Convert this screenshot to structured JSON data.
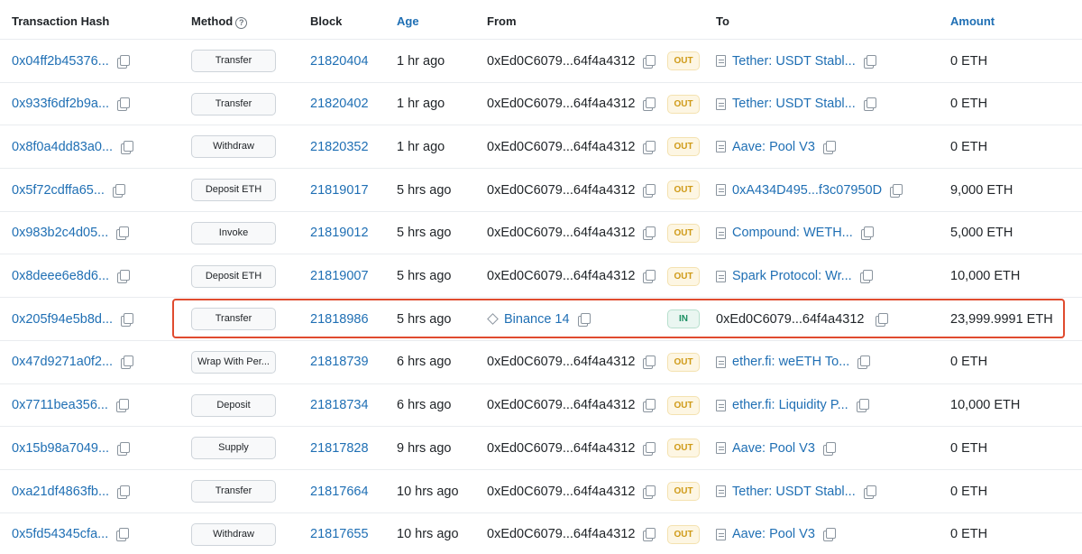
{
  "headers": {
    "hash": "Transaction Hash",
    "method": "Method",
    "block": "Block",
    "age": "Age",
    "from": "From",
    "to": "To",
    "amount": "Amount"
  },
  "rows": [
    {
      "hash": "0x04ff2b45376...",
      "method": "Transfer",
      "block": "21820404",
      "age": "1 hr ago",
      "from": "0xEd0C6079...64f4a4312",
      "dir": "OUT",
      "to": "Tether: USDT Stabl...",
      "amount": "0 ETH"
    },
    {
      "hash": "0x933f6df2b9a...",
      "method": "Transfer",
      "block": "21820402",
      "age": "1 hr ago",
      "from": "0xEd0C6079...64f4a4312",
      "dir": "OUT",
      "to": "Tether: USDT Stabl...",
      "amount": "0 ETH"
    },
    {
      "hash": "0x8f0a4dd83a0...",
      "method": "Withdraw",
      "block": "21820352",
      "age": "1 hr ago",
      "from": "0xEd0C6079...64f4a4312",
      "dir": "OUT",
      "to": "Aave: Pool V3",
      "amount": "0 ETH"
    },
    {
      "hash": "0x5f72cdffa65...",
      "method": "Deposit ETH",
      "block": "21819017",
      "age": "5 hrs ago",
      "from": "0xEd0C6079...64f4a4312",
      "dir": "OUT",
      "to": "0xA434D495...f3c07950D",
      "amount": "9,000 ETH"
    },
    {
      "hash": "0x983b2c4d05...",
      "method": "Invoke",
      "block": "21819012",
      "age": "5 hrs ago",
      "from": "0xEd0C6079...64f4a4312",
      "dir": "OUT",
      "to": "Compound: WETH...",
      "amount": "5,000 ETH"
    },
    {
      "hash": "0x8deee6e8d6...",
      "method": "Deposit ETH",
      "block": "21819007",
      "age": "5 hrs ago",
      "from": "0xEd0C6079...64f4a4312",
      "dir": "OUT",
      "to": "Spark Protocol: Wr...",
      "amount": "10,000 ETH"
    },
    {
      "hash": "0x205f94e5b8d...",
      "method": "Transfer",
      "block": "21818986",
      "age": "5 hrs ago",
      "from": "Binance 14",
      "dir": "IN",
      "to": "0xEd0C6079...64f4a4312",
      "amount": "23,999.9991 ETH"
    },
    {
      "hash": "0x47d9271a0f2...",
      "method": "Wrap With Per...",
      "block": "21818739",
      "age": "6 hrs ago",
      "from": "0xEd0C6079...64f4a4312",
      "dir": "OUT",
      "to": "ether.fi: weETH To...",
      "amount": "0 ETH"
    },
    {
      "hash": "0x7711bea356...",
      "method": "Deposit",
      "block": "21818734",
      "age": "6 hrs ago",
      "from": "0xEd0C6079...64f4a4312",
      "dir": "OUT",
      "to": "ether.fi: Liquidity P...",
      "amount": "10,000 ETH"
    },
    {
      "hash": "0x15b98a7049...",
      "method": "Supply",
      "block": "21817828",
      "age": "9 hrs ago",
      "from": "0xEd0C6079...64f4a4312",
      "dir": "OUT",
      "to": "Aave: Pool V3",
      "amount": "0 ETH"
    },
    {
      "hash": "0xa21df4863fb...",
      "method": "Transfer",
      "block": "21817664",
      "age": "10 hrs ago",
      "from": "0xEd0C6079...64f4a4312",
      "dir": "OUT",
      "to": "Tether: USDT Stabl...",
      "amount": "0 ETH"
    },
    {
      "hash": "0x5fd54345cfa...",
      "method": "Withdraw",
      "block": "21817655",
      "age": "10 hrs ago",
      "from": "0xEd0C6079...64f4a4312",
      "dir": "OUT",
      "to": "Aave: Pool V3",
      "amount": "0 ETH"
    }
  ],
  "colors": {
    "link": "#1f6fb4",
    "out_badge": "#cf9a17",
    "in_badge": "#1b8f62",
    "highlight": "#e04b2f"
  },
  "icons": [
    "help-icon",
    "copy-icon",
    "document-icon",
    "diamond-icon"
  ]
}
